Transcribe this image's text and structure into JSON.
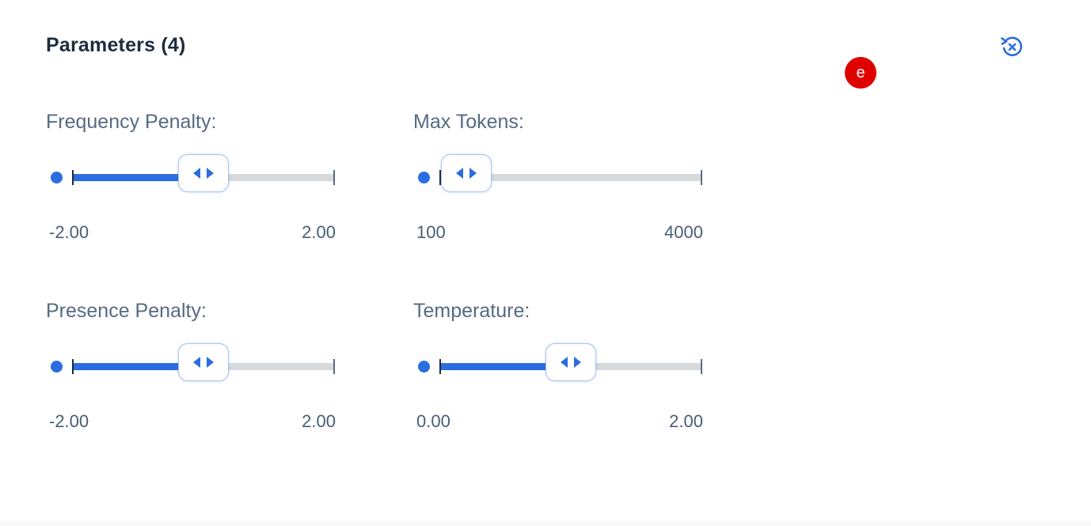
{
  "header": {
    "title": "Parameters (4)",
    "reset_icon": "reset-clear-icon",
    "accent_color": "#2a6de0"
  },
  "badge": {
    "label": "e",
    "color": "#e00000"
  },
  "params": [
    {
      "label": "Frequency Penalty:",
      "min": "-2.00",
      "max": "2.00",
      "fraction": 0.5
    },
    {
      "label": "Max Tokens:",
      "min": "100",
      "max": "4000",
      "fraction": 0.1
    },
    {
      "label": "Presence Penalty:",
      "min": "-2.00",
      "max": "2.00",
      "fraction": 0.5
    },
    {
      "label": "Temperature:",
      "min": "0.00",
      "max": "2.00",
      "fraction": 0.5
    }
  ]
}
